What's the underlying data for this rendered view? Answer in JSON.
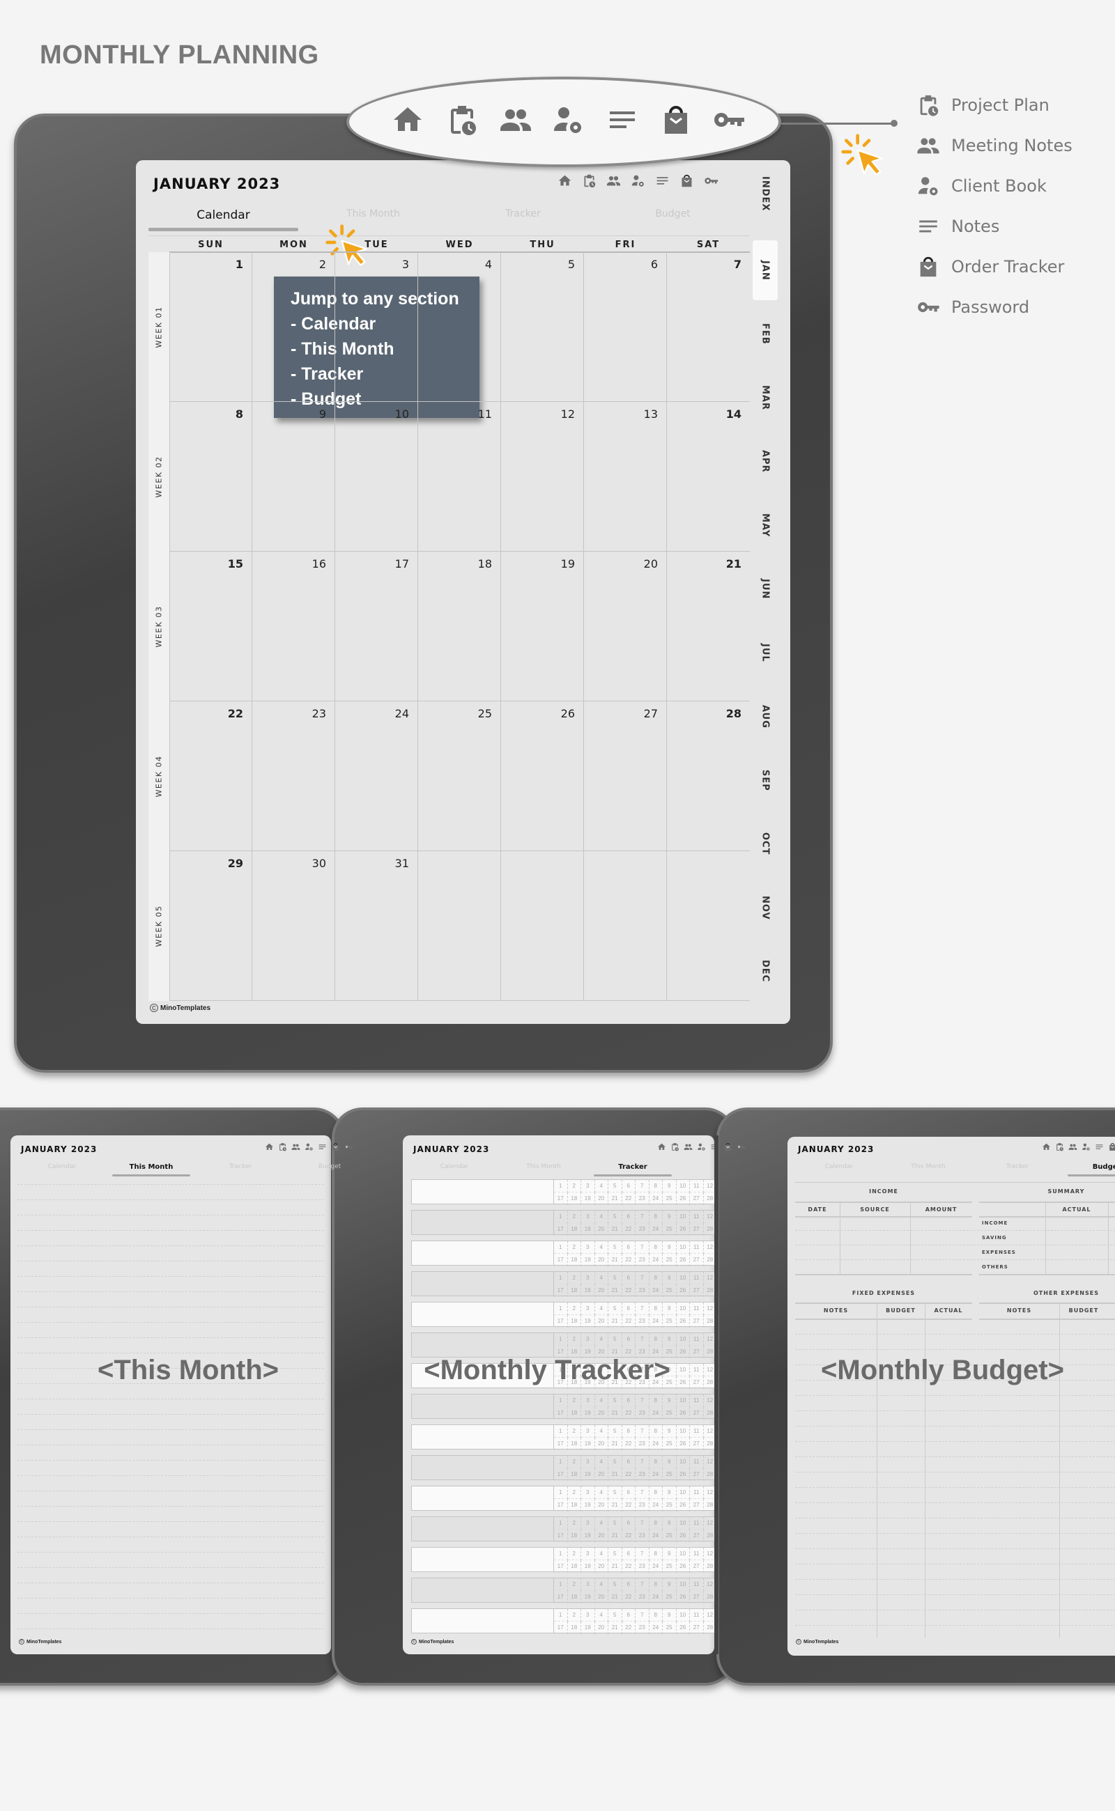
{
  "page_title": "MONTHLY PLANNING",
  "nav_icons": [
    "home-icon",
    "project-plan-icon",
    "meeting-notes-icon",
    "client-book-icon",
    "notes-icon",
    "order-tracker-icon",
    "password-icon"
  ],
  "legend": [
    {
      "icon": "project-plan-icon",
      "label": "Project Plan"
    },
    {
      "icon": "meeting-notes-icon",
      "label": "Meeting Notes"
    },
    {
      "icon": "client-book-icon",
      "label": "Client Book"
    },
    {
      "icon": "notes-icon",
      "label": "Notes"
    },
    {
      "icon": "order-tracker-icon",
      "label": "Order Tracker"
    },
    {
      "icon": "password-icon",
      "label": "Password"
    }
  ],
  "planner": {
    "title": "JANUARY 2023",
    "tabs": [
      "Calendar",
      "This Month",
      "Tracker",
      "Budget"
    ],
    "active_tab": "Calendar",
    "weekdays": [
      "SUN",
      "MON",
      "TUE",
      "WED",
      "THU",
      "FRI",
      "SAT"
    ],
    "weeks": [
      {
        "label": "WEEK 01",
        "days": [
          "1",
          "2",
          "3",
          "4",
          "5",
          "6",
          "7"
        ]
      },
      {
        "label": "WEEK 02",
        "days": [
          "8",
          "9",
          "10",
          "11",
          "12",
          "13",
          "14"
        ]
      },
      {
        "label": "WEEK 03",
        "days": [
          "15",
          "16",
          "17",
          "18",
          "19",
          "20",
          "21"
        ]
      },
      {
        "label": "WEEK 04",
        "days": [
          "22",
          "23",
          "24",
          "25",
          "26",
          "27",
          "28"
        ]
      },
      {
        "label": "WEEK 05",
        "days": [
          "29",
          "30",
          "31",
          "",
          "",
          "",
          ""
        ]
      }
    ],
    "side_tabs": [
      "INDEX",
      "JAN",
      "FEB",
      "MAR",
      "APR",
      "MAY",
      "JUN",
      "JUL",
      "AUG",
      "SEP",
      "OCT",
      "NOV",
      "DEC"
    ],
    "active_side_tab": "JAN",
    "footer": "MinoTemplates",
    "copyright_symbol": "C"
  },
  "tooltip": {
    "lines": [
      "Jump to any section",
      "- Calendar",
      "- This Month",
      "- Tracker",
      "- Budget"
    ],
    "background": "#4e5a68"
  },
  "accent_color": "#f2a51a",
  "previews": {
    "this_month": {
      "title": "JANUARY 2023",
      "tabs": [
        "Calendar",
        "This Month",
        "Tracker",
        "Budget"
      ],
      "active_tab": "This Month",
      "caption": "<This Month>",
      "footer": "MinoTemplates"
    },
    "tracker": {
      "title": "JANUARY 2023",
      "tabs": [
        "Calendar",
        "This Month",
        "Tracker"
      ],
      "active_tab": "Tracker",
      "caption": "<Monthly Tracker>",
      "footer": "MinoTemplates",
      "row_top_numbers": [
        "1",
        "2",
        "3",
        "4",
        "5",
        "6",
        "7",
        "8",
        "9",
        "10",
        "11",
        "12"
      ],
      "row_bottom_numbers": [
        "17",
        "18",
        "19",
        "20",
        "21",
        "22",
        "23",
        "24",
        "25",
        "26",
        "27",
        "28"
      ]
    },
    "budget": {
      "title": "JANUARY 2023",
      "tabs": [
        "Calendar",
        "This Month",
        "Tracker",
        "Budget"
      ],
      "active_tab": "Budget",
      "caption": "<Monthly Budget>",
      "footer": "MinoTemplates",
      "income": {
        "heading": "INCOME",
        "columns": [
          "DATE",
          "SOURCE",
          "AMOUNT"
        ]
      },
      "summary": {
        "heading": "SUMMARY",
        "columns": [
          "ACTUAL"
        ],
        "rows": [
          "INCOME",
          "SAVING",
          "EXPENSES",
          "OTHERS"
        ]
      },
      "fixed_expenses": {
        "heading": "FIXED EXPENSES",
        "columns": [
          "NOTES",
          "BUDGET",
          "ACTUAL"
        ]
      },
      "other_expenses": {
        "heading": "OTHER EXPENSES",
        "columns": [
          "NOTES",
          "BUDGET"
        ]
      }
    }
  }
}
